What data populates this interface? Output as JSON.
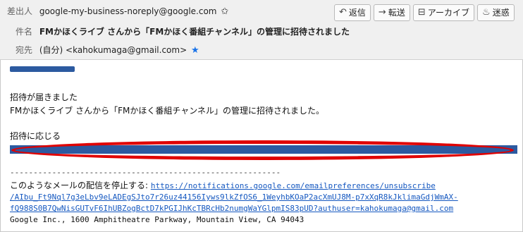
{
  "header": {
    "from_label": "差出人",
    "from_value": "google-my-business-noreply@google.com",
    "subject_label": "件名",
    "subject_value": "FMかほくライブ さんから「FMかほく番組チャンネル」の管理に招待されました",
    "to_label": "宛先",
    "to_value": "(自分) <kahokumaga@gmail.com>"
  },
  "toolbar": {
    "reply_label": "返信",
    "forward_label": "転送",
    "archive_label": "アーカイブ",
    "junk_label": "迷惑"
  },
  "body": {
    "invite_heading": "招待が届きました",
    "invite_text": "FMかほくライブ さんから「FMかほく番組チャンネル」の管理に招待されました。",
    "respond_label": "招待に応じる",
    "separator": "----------------------------------------------------------",
    "unsubscribe_text": "このようなメールの配信を停止する: ",
    "unsubscribe_link_1": "https://notifications.google.com/emailpreferences/unsubscribe",
    "unsubscribe_link_2": "/AIbu_Ft9Nql7g3eLbv9eLADEgSJto7r26uz44156Iyws9lkZfOS6_1WeyhbKOaP2acXmUJ8M-p7xXqR8kJklimaGdjWmAX-",
    "unsubscribe_link_3": "fQ988S0B7QwNisGUTvF6IhUBZogBctD7kPGIJhKcTBRcHb2numgWaYGlpmIS83pUD?authuser=kahokumaga@gmail.com",
    "footer_address": "Google Inc., 1600 Amphitheatre Parkway, Mountain View, CA 94043"
  },
  "colors": {
    "link": "#1558c0",
    "redaction": "#2c5aa0",
    "annotation": "#e00000",
    "star": "#1a73e8"
  }
}
